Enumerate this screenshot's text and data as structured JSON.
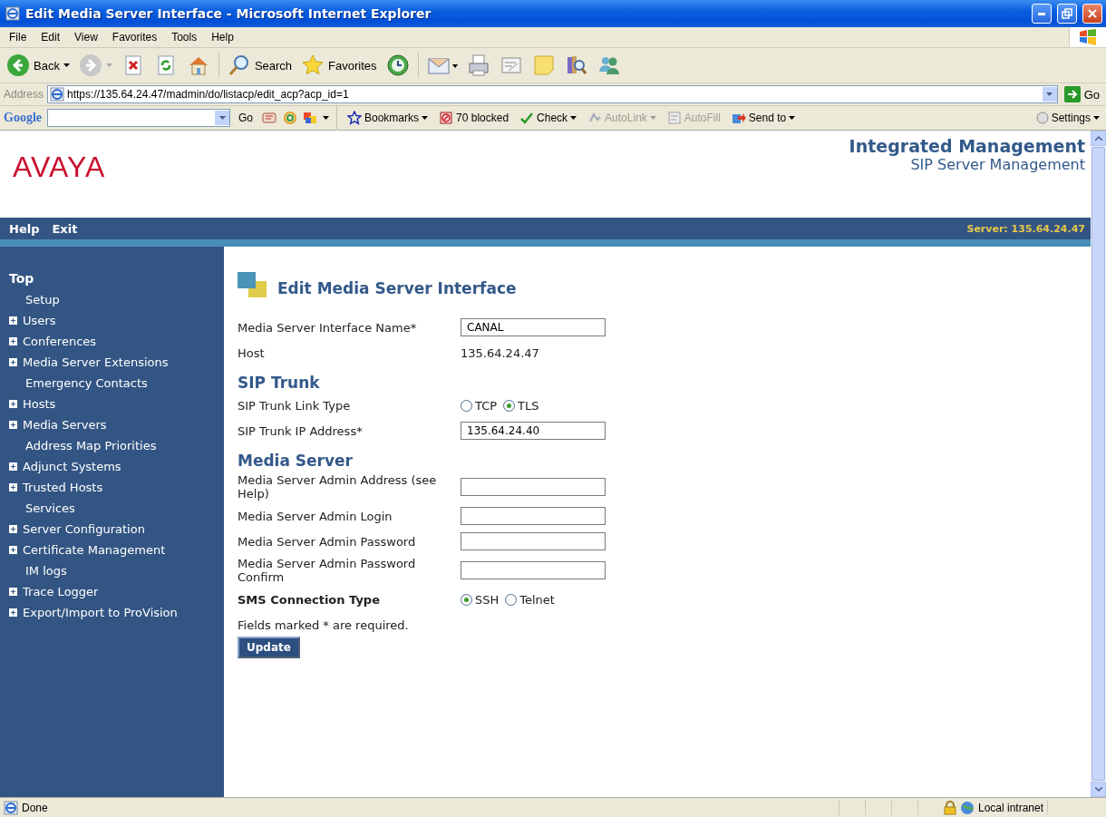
{
  "window": {
    "title": "Edit Media Server Interface - Microsoft Internet Explorer"
  },
  "menu": [
    {
      "label": "File"
    },
    {
      "label": "Edit"
    },
    {
      "label": "View"
    },
    {
      "label": "Favorites"
    },
    {
      "label": "Tools"
    },
    {
      "label": "Help"
    }
  ],
  "toolbar": [
    {
      "kind": "back",
      "label": "Back"
    },
    {
      "kind": "forward"
    },
    {
      "kind": "stop"
    },
    {
      "kind": "refresh"
    },
    {
      "kind": "home"
    },
    {
      "kind": "search",
      "label": "Search"
    },
    {
      "kind": "favorites",
      "label": "Favorites"
    },
    {
      "kind": "history"
    },
    {
      "kind": "mail"
    },
    {
      "kind": "print"
    },
    {
      "kind": "edit"
    },
    {
      "kind": "note"
    },
    {
      "kind": "research"
    },
    {
      "kind": "messenger"
    }
  ],
  "address_bar": {
    "label": "Address",
    "url": "https://135.64.24.47/madmin/do/listacp/edit_acp?acp_id=1",
    "go": "Go"
  },
  "google_bar": {
    "brand": "Google",
    "go": "Go",
    "items": [
      {
        "kind": "bookmarks",
        "label": "Bookmarks",
        "disabled": false
      },
      {
        "kind": "blocked",
        "label": "70 blocked",
        "disabled": false
      },
      {
        "kind": "check",
        "label": "Check",
        "disabled": false
      },
      {
        "kind": "autolink",
        "label": "AutoLink",
        "disabled": true
      },
      {
        "kind": "autofill",
        "label": "AutoFill",
        "disabled": true
      },
      {
        "kind": "sendto",
        "label": "Send to",
        "disabled": false
      }
    ],
    "settings": "Settings"
  },
  "header": {
    "logo": "AVAYA",
    "title": "Integrated Management",
    "subtitle": "SIP Server Management"
  },
  "nav": {
    "links": [
      {
        "label": "Help"
      },
      {
        "label": "Exit"
      }
    ],
    "server": "Server: 135.64.24.47"
  },
  "sidebar": {
    "items": [
      {
        "kind": "heading",
        "label": "Top"
      },
      {
        "kind": "link",
        "label": "Setup"
      },
      {
        "kind": "group",
        "label": "Users"
      },
      {
        "kind": "group",
        "label": "Conferences"
      },
      {
        "kind": "group",
        "label": "Media Server Extensions"
      },
      {
        "kind": "link",
        "label": "Emergency Contacts"
      },
      {
        "kind": "group",
        "label": "Hosts"
      },
      {
        "kind": "group",
        "label": "Media Servers"
      },
      {
        "kind": "link",
        "label": "Address Map Priorities"
      },
      {
        "kind": "group",
        "label": "Adjunct Systems"
      },
      {
        "kind": "group",
        "label": "Trusted Hosts"
      },
      {
        "kind": "link",
        "label": "Services"
      },
      {
        "kind": "group",
        "label": "Server Configuration"
      },
      {
        "kind": "group",
        "label": "Certificate Management"
      },
      {
        "kind": "link",
        "label": "IM logs"
      },
      {
        "kind": "group",
        "label": "Trace Logger"
      },
      {
        "kind": "group",
        "label": "Export/Import to ProVision"
      }
    ]
  },
  "form": {
    "title": "Edit Media Server Interface",
    "rows": [
      {
        "kind": "input",
        "label": "Media Server Interface Name*",
        "value": "CANAL"
      },
      {
        "kind": "text",
        "label": "Host",
        "value": "135.64.24.47"
      },
      {
        "kind": "section",
        "label": "SIP Trunk"
      },
      {
        "kind": "radio",
        "label": "SIP Trunk Link Type",
        "bold": false,
        "options": [
          {
            "label": "TCP",
            "selected": false
          },
          {
            "label": "TLS",
            "selected": true
          }
        ]
      },
      {
        "kind": "input",
        "label": "SIP Trunk IP Address*",
        "value": "135.64.24.40"
      },
      {
        "kind": "section",
        "label": "Media Server"
      },
      {
        "kind": "input",
        "label": "Media Server Admin Address (see Help)"
      },
      {
        "kind": "input",
        "label": "Media Server Admin Login"
      },
      {
        "kind": "input",
        "label": "Media Server Admin Password"
      },
      {
        "kind": "input",
        "label": "Media Server Admin Password Confirm"
      },
      {
        "kind": "radio",
        "label": "SMS Connection Type",
        "bold": true,
        "options": [
          {
            "label": "SSH",
            "selected": true
          },
          {
            "label": "Telnet",
            "selected": false
          }
        ]
      }
    ],
    "note": "Fields marked * are required.",
    "submit": "Update"
  },
  "status_bar": {
    "text": "Done",
    "zone": "Local intranet"
  }
}
